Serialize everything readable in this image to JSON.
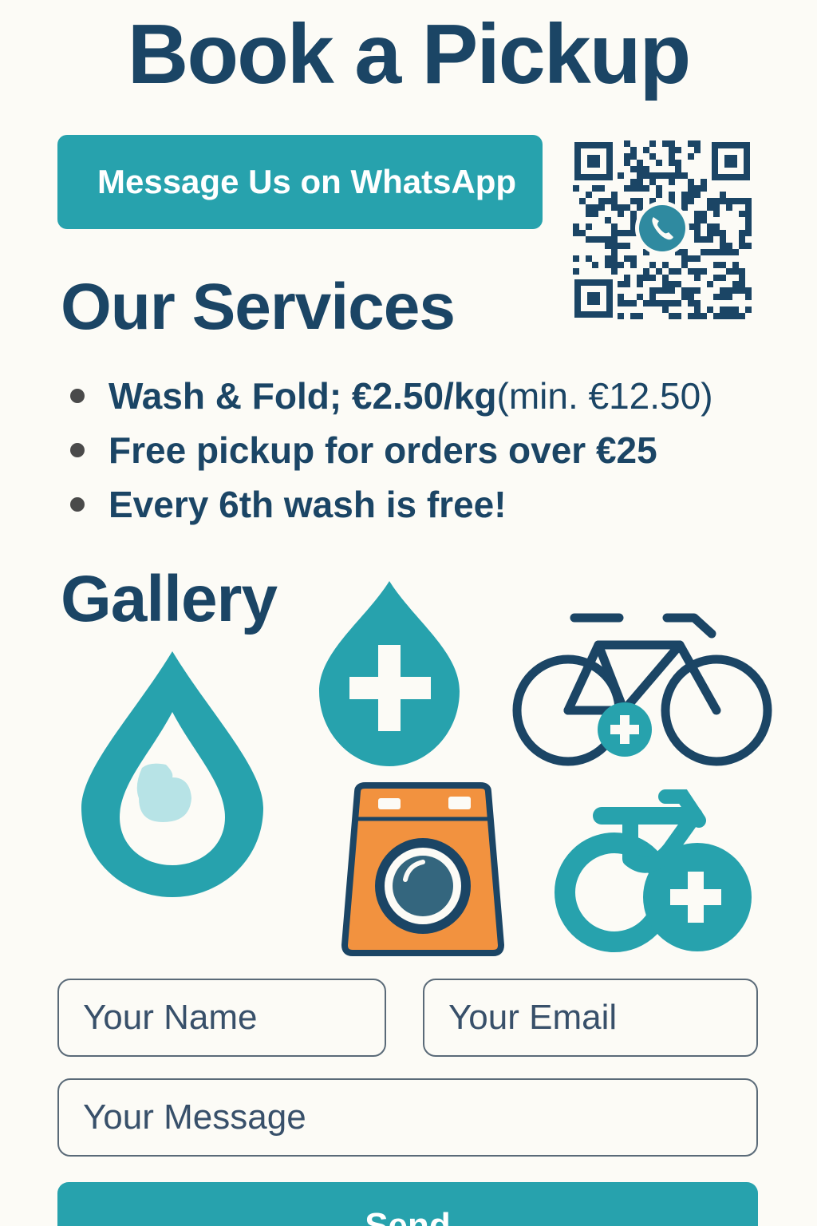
{
  "header": {
    "title": "Book a Pickup"
  },
  "contact": {
    "whatsapp_label": "Message Us on WhatsApp",
    "qr_icon": "qr-code-icon",
    "qr_center_icon": "phone-icon"
  },
  "services": {
    "title": "Our Services",
    "items": [
      {
        "bold": "Wash & Fold; €2.50/kg",
        "light": " (min. €12.50)"
      },
      {
        "bold": "Free pickup for orders over €25",
        "light": ""
      },
      {
        "bold": "Every 6th wash is free!",
        "light": ""
      }
    ]
  },
  "gallery": {
    "title": "Gallery",
    "icons": [
      "water-drop-icon",
      "drop-plus-icon",
      "bicycle-plus-icon",
      "washing-machine-icon",
      "bike-plus-icon"
    ]
  },
  "form": {
    "name_placeholder": "Your Name",
    "email_placeholder": "Your Email",
    "message_placeholder": "Your Message",
    "send_label": "Send"
  },
  "colors": {
    "background": "#fcfbf6",
    "heading": "#1b4565",
    "teal": "#27a2ad",
    "orange": "#f2923f"
  }
}
